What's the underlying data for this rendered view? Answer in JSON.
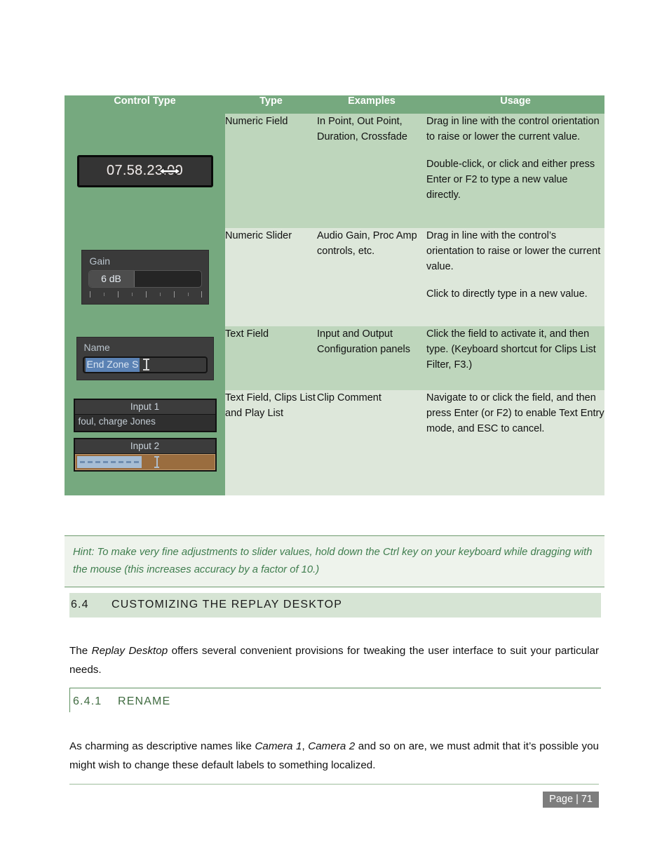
{
  "table": {
    "headers": [
      "Control Type",
      "Type",
      "Examples",
      "Usage"
    ],
    "rows": [
      {
        "type": "Numeric Field",
        "examples": "In Point, Out Point, Duration, Crossfade",
        "usage_1": "Drag in line with the control orientation to raise or lower the current value.",
        "usage_2": "Double-click, or click and either press Enter or F2 to type a new value directly.",
        "widget": {
          "kind": "numeric-field",
          "value": "07.58.23.00",
          "cursor": "horizontal-resize-cursor"
        }
      },
      {
        "type": "Numeric Slider",
        "examples": "Audio Gain, Proc Amp controls, etc.",
        "usage_1": "Drag in line with the control’s orientation to raise or lower the current value.",
        "usage_2": "Click to directly type in a new value.",
        "widget": {
          "kind": "numeric-slider",
          "label": "Gain",
          "value": "6 dB"
        }
      },
      {
        "type": "Text Field",
        "examples": "Input and Output Configuration panels",
        "usage_1": "Click the field to activate it, and then type. (Keyboard shortcut for Clips List Filter, F3.)",
        "usage_2": "",
        "widget": {
          "kind": "text-field",
          "label": "Name",
          "value": "End Zone S",
          "cursor": "text-ibeam-cursor"
        }
      },
      {
        "type": "Text Field, Clips List and Play List",
        "examples": "Clip Comment",
        "usage_1": "Navigate to or click the field, and then press Enter (or F2) to enable Text Entry mode, and ESC to cancel.",
        "usage_2": "",
        "widget": {
          "kind": "clip-comment-inputs",
          "input1_title": "Input 1",
          "input1_comment": "foul, charge Jones",
          "input2_title": "Input 2",
          "input2_comment": "",
          "cursor": "text-ibeam-cursor"
        }
      }
    ]
  },
  "hint": {
    "text": "Hint: To make very fine adjustments to slider values, hold down the Ctrl key on your keyboard while dragging with the mouse (this increases accuracy by a factor of 10.)"
  },
  "section": {
    "number": "6.4",
    "title": "CUSTOMIZING THE REPLAY DESKTOP"
  },
  "subsection": {
    "number": "6.4.1",
    "title": "RENAME"
  },
  "paragraphs": {
    "p1_a": "The ",
    "p1_em": "Replay Desktop",
    "p1_b": " offers several convenient provisions for tweaking the user interface to suit your particular needs.",
    "p2_a": "As charming as descriptive names like ",
    "p2_em1": "Camera 1",
    "p2_mid": ", ",
    "p2_em2": "Camera 2",
    "p2_b": " and so on are, we must admit that it’s possible you might wish to change these default labels to something localized."
  },
  "footer": {
    "page_label": "Page  |  71"
  },
  "colors": {
    "header_green": "#76a97f",
    "row_dark": "#bed6bc",
    "row_light": "#dde7da",
    "hint_text": "#3f7d4e",
    "hint_bg": "#eef3ec",
    "h2_bg": "#d6e4d4",
    "h3_text": "#3f6b40",
    "page_badge_bg": "#7d7d7d"
  }
}
